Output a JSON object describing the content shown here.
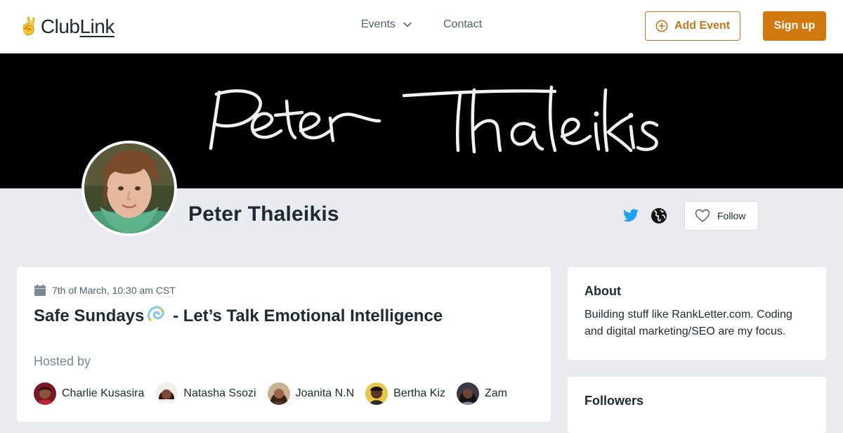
{
  "nav": {
    "logo_prefix": "Club",
    "logo_suffix": "Link",
    "events_label": "Events",
    "contact_label": "Contact",
    "add_event_label": "Add Event",
    "signup_label": "Sign up"
  },
  "banner": {
    "text": "Peter Thaleikis"
  },
  "profile": {
    "name": "Peter Thaleikis",
    "follow_label": "Follow"
  },
  "event": {
    "date": "7th of March, 10:30 am CST",
    "title_prefix": "Safe Sundays",
    "title_suffix": " - Let’s Talk Emotional Intelligence",
    "hosted_by_label": "Hosted by",
    "hosts": [
      {
        "name": "Charlie Kusasira"
      },
      {
        "name": "Natasha Ssozi"
      },
      {
        "name": "Joanita N.N"
      },
      {
        "name": "Bertha Kiz"
      },
      {
        "name": "Zam"
      }
    ]
  },
  "about": {
    "title": "About",
    "text": "Building stuff like RankLetter.com. Coding and digital marketing/SEO are my focus."
  },
  "followers": {
    "title": "Followers"
  },
  "colors": {
    "accent": "#d1790f",
    "twitter": "#1da1f2"
  }
}
